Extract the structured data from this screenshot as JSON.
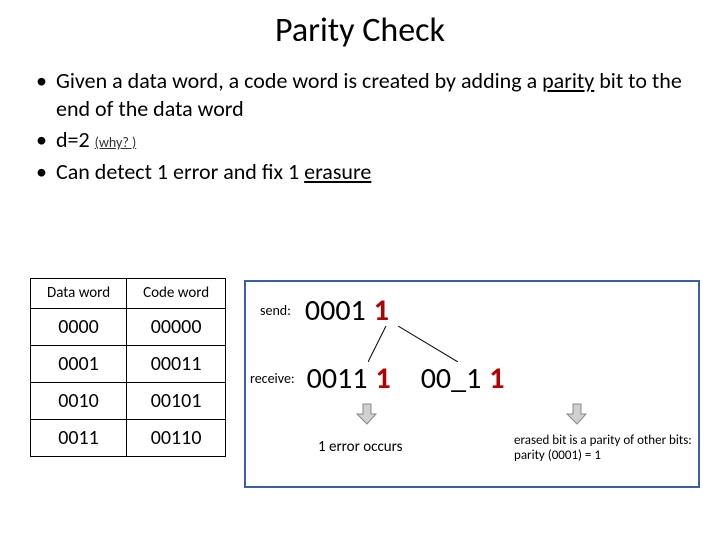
{
  "title": "Parity Check",
  "bullets": {
    "b1_pre": "Given a data word, a code word is created by adding a ",
    "b1_u": "parity",
    "b1_post": " bit to the end of the data word",
    "b2_pre": "d=2 ",
    "b2_why": "(why? )",
    "b3_pre": "Can detect 1 error and fix 1 ",
    "b3_u": "erasure"
  },
  "table": {
    "h1": "Data word",
    "h2": "Code word",
    "r1c1": "0000",
    "r1c2": "00000",
    "r2c1": "0001",
    "r2c2": "00011",
    "r3c1": "0010",
    "r3c2": "00101",
    "r4c1": "0011",
    "r4c2": "00110"
  },
  "diagram": {
    "send_lbl": "send:",
    "send_data": "0001",
    "send_parity": "1",
    "recv_lbl": "receive:",
    "recv1_data": "0011",
    "recv1_parity": "1",
    "recv2_data": "00_1",
    "recv2_parity": "1",
    "note1": "1 error occurs",
    "note2": "erased bit is a parity of other bits: parity (0001) = 1"
  }
}
